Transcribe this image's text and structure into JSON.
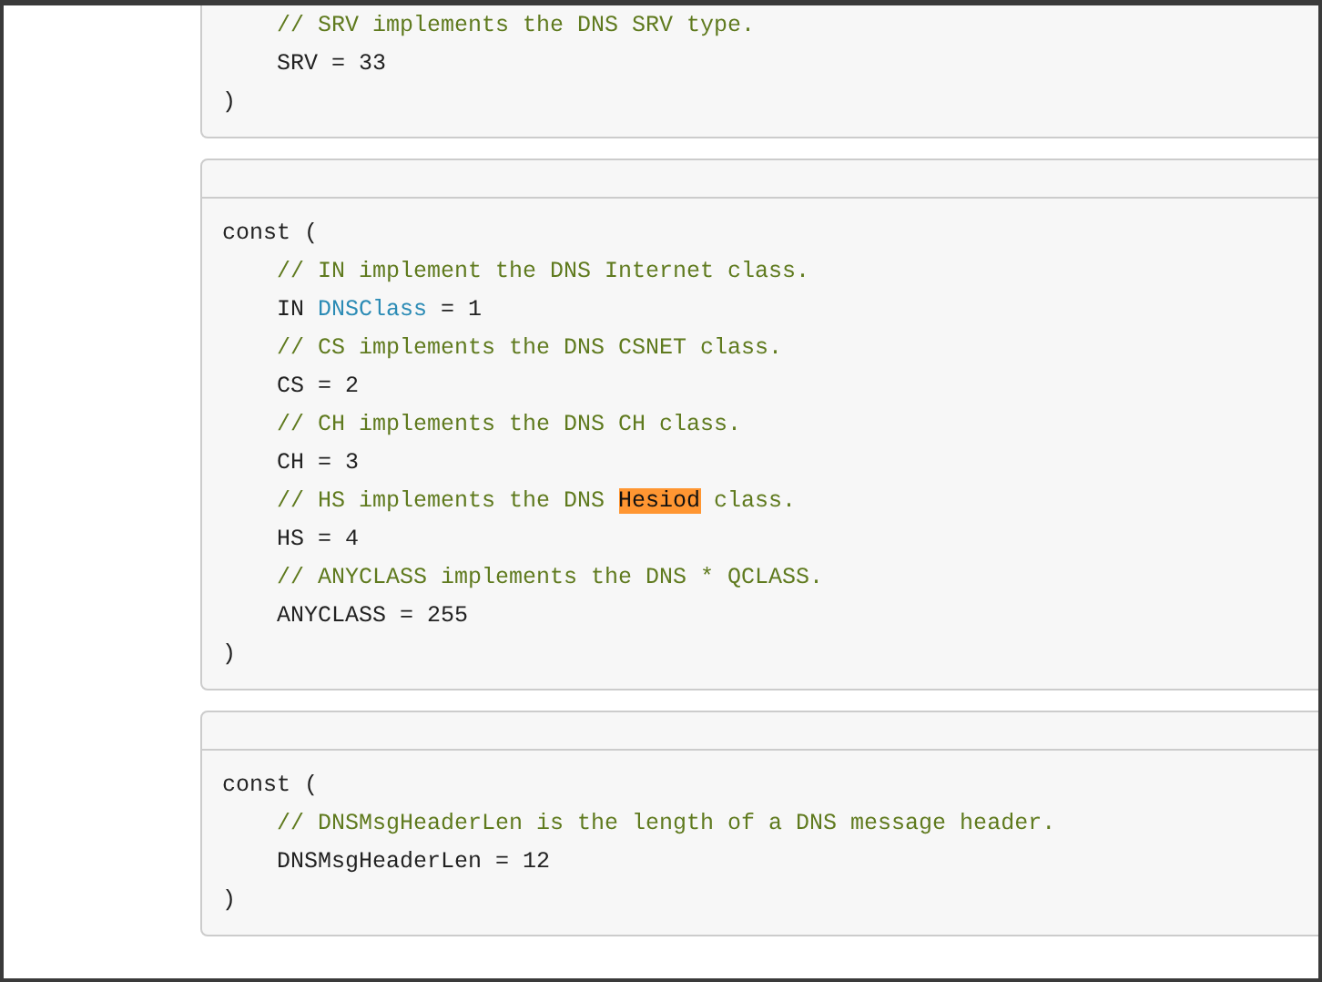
{
  "code_blocks": [
    {
      "header": false,
      "lines": [
        [
          {
            "kind": "comment",
            "text": "// SRV implements the DNS SRV type."
          }
        ],
        [
          {
            "kind": "code",
            "text": "SRV = 33"
          }
        ]
      ],
      "closer": ")"
    },
    {
      "header": true,
      "opener": "const (",
      "lines": [
        [
          {
            "kind": "comment",
            "text": "// IN implement the DNS Internet class."
          }
        ],
        [
          {
            "kind": "code",
            "text": "IN "
          },
          {
            "kind": "type",
            "text": "DNSClass"
          },
          {
            "kind": "code",
            "text": " = 1"
          }
        ],
        [
          {
            "kind": "comment",
            "text": "// CS implements the DNS CSNET class."
          }
        ],
        [
          {
            "kind": "code",
            "text": "CS = 2"
          }
        ],
        [
          {
            "kind": "comment",
            "text": "// CH implements the DNS CH class."
          }
        ],
        [
          {
            "kind": "code",
            "text": "CH = 3"
          }
        ],
        [
          {
            "kind": "comment",
            "text": "// HS implements the DNS "
          },
          {
            "kind": "highlight",
            "text": "Hesiod"
          },
          {
            "kind": "comment",
            "text": " class."
          }
        ],
        [
          {
            "kind": "code",
            "text": "HS = 4"
          }
        ],
        [
          {
            "kind": "comment",
            "text": "// ANYCLASS implements the DNS * QCLASS."
          }
        ],
        [
          {
            "kind": "code",
            "text": "ANYCLASS = 255"
          }
        ]
      ],
      "closer": ")"
    },
    {
      "header": true,
      "opener": "const (",
      "lines": [
        [
          {
            "kind": "comment",
            "text": "// DNSMsgHeaderLen is the length of a DNS message header."
          }
        ],
        [
          {
            "kind": "code",
            "text": "DNSMsgHeaderLen = 12"
          }
        ]
      ],
      "closer": ")"
    }
  ]
}
